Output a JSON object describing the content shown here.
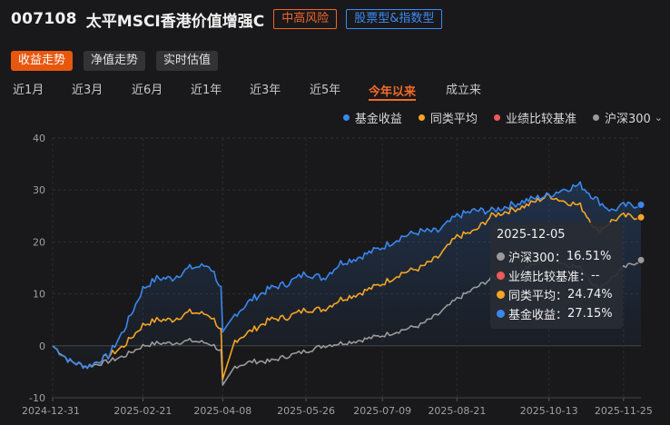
{
  "header": {
    "code": "007108",
    "name": "太平MSCI香港价值增强C",
    "risk_tag": "中高风险",
    "type_tag": "股票型&指数型"
  },
  "view_tabs": [
    {
      "label": "收益走势",
      "active": true
    },
    {
      "label": "净值走势",
      "active": false
    },
    {
      "label": "实时估值",
      "active": false
    }
  ],
  "period_tabs": [
    {
      "label": "近1月",
      "active": false
    },
    {
      "label": "近3月",
      "active": false
    },
    {
      "label": "近6月",
      "active": false
    },
    {
      "label": "近1年",
      "active": false
    },
    {
      "label": "近3年",
      "active": false
    },
    {
      "label": "近5年",
      "active": false
    },
    {
      "label": "今年以来",
      "active": true
    },
    {
      "label": "成立来",
      "active": false
    }
  ],
  "legend": [
    {
      "label": "基金收益",
      "color": "#3a87f0"
    },
    {
      "label": "同类平均",
      "color": "#f5a623"
    },
    {
      "label": "业绩比较基准",
      "color": "#f05a5a"
    },
    {
      "label": "沪深300",
      "color": "#9a9a9a"
    }
  ],
  "tooltip": {
    "date": "2025-12-05",
    "rows": [
      {
        "label": "沪深300",
        "value": "16.51%",
        "color": "#9a9a9a"
      },
      {
        "label": "业绩比较基准",
        "value": "--",
        "color": "#f05a5a"
      },
      {
        "label": "同类平均",
        "value": "24.74%",
        "color": "#f5a623"
      },
      {
        "label": "基金收益",
        "value": "27.15%",
        "color": "#3a87f0"
      }
    ]
  },
  "chart_data": {
    "type": "line",
    "ylim": [
      -10,
      40
    ],
    "yticks": [
      -10,
      0,
      10,
      20,
      30,
      40
    ],
    "ylabel_unit": "",
    "xtick_labels": [
      "2024-12-31",
      "2025-02-21",
      "2025-04-08",
      "2025-05-26",
      "2025-07-09",
      "2025-08-21",
      "2025-10-13",
      "2025-11-25"
    ],
    "x": [
      "2024-12-31",
      "2025-01-10",
      "2025-01-20",
      "2025-02-01",
      "2025-02-10",
      "2025-02-21",
      "2025-03-01",
      "2025-03-10",
      "2025-03-20",
      "2025-03-31",
      "2025-04-03",
      "2025-04-07",
      "2025-04-08",
      "2025-04-15",
      "2025-04-25",
      "2025-05-05",
      "2025-05-15",
      "2025-05-26",
      "2025-06-05",
      "2025-06-15",
      "2025-06-25",
      "2025-07-09",
      "2025-07-20",
      "2025-07-31",
      "2025-08-10",
      "2025-08-21",
      "2025-08-31",
      "2025-09-10",
      "2025-09-20",
      "2025-09-30",
      "2025-10-13",
      "2025-10-20",
      "2025-10-31",
      "2025-11-10",
      "2025-11-18",
      "2025-11-25",
      "2025-12-05"
    ],
    "series": [
      {
        "name": "基金收益",
        "color": "#3a87f0",
        "values": [
          0,
          -3,
          -4,
          -2,
          3,
          11,
          13,
          13,
          15,
          15.5,
          14,
          11,
          2,
          6,
          9,
          11,
          12,
          14,
          13,
          16,
          17,
          19,
          21,
          22,
          22,
          25,
          26,
          26,
          27,
          28,
          29,
          30,
          31,
          28,
          26,
          27,
          27.15
        ]
      },
      {
        "name": "同类平均",
        "color": "#f5a623",
        "values": [
          0,
          -3,
          -4,
          -2,
          0,
          4,
          5,
          5,
          6.5,
          6,
          5,
          3,
          -7,
          1,
          3,
          5,
          5.5,
          7,
          7,
          9,
          10,
          12,
          14,
          15,
          17,
          21,
          22,
          25,
          26,
          27,
          29,
          28,
          27,
          22,
          24,
          25,
          24.74
        ]
      },
      {
        "name": "沪深300",
        "color": "#9a9a9a",
        "values": [
          0,
          -3,
          -4,
          -3,
          -2,
          0,
          0.5,
          0.5,
          1,
          0.5,
          0,
          -1,
          -8,
          -4,
          -3,
          -3,
          -2,
          -1,
          0,
          0.5,
          1,
          2,
          3,
          4,
          6,
          9,
          11,
          13,
          13,
          15,
          17,
          16,
          15,
          11,
          13,
          15,
          16.51
        ]
      },
      {
        "name": "业绩比较基准",
        "color": "#f05a5a",
        "values": []
      }
    ],
    "grid": true,
    "legend_position": "top-right"
  }
}
